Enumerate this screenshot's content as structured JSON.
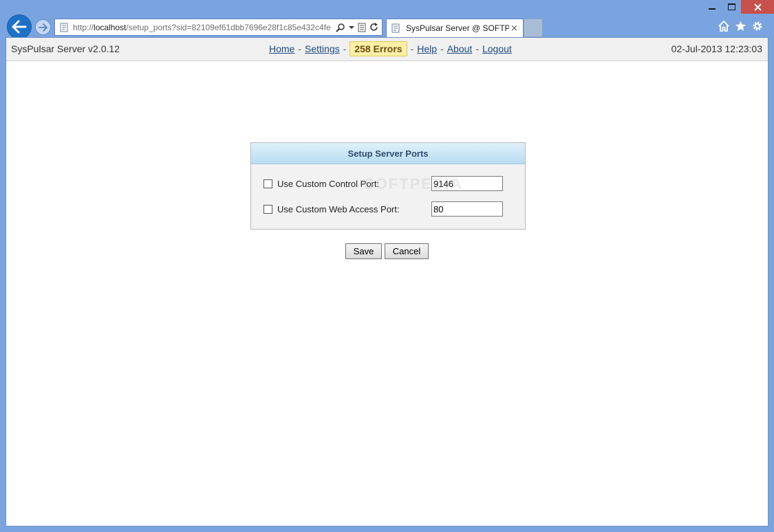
{
  "browser": {
    "address_prefix": "http://",
    "address_host": "localhost",
    "address_path": "/setup_ports?sid=82109ef61dbb7696e28f1c85e432c4fe",
    "tab_title": "SysPulsar Server @ SOFTPE...",
    "tab_close": "×"
  },
  "header": {
    "app_title": "SysPulsar Server v2.0.12",
    "nav": {
      "home": "Home",
      "settings": "Settings",
      "errors": "258 Errors",
      "help": "Help",
      "about": "About",
      "logout": "Logout",
      "separator": "-"
    },
    "datetime": "02-Jul-2013 12:23:03"
  },
  "panel": {
    "title": "Setup Server Ports",
    "control_port": {
      "label": "Use Custom Control Port:",
      "value": "9146",
      "checked": false
    },
    "web_port": {
      "label": "Use Custom Web Access Port:",
      "value": "80",
      "checked": false
    }
  },
  "actions": {
    "save": "Save",
    "cancel": "Cancel"
  },
  "watermark": "SOFTPEDIA"
}
